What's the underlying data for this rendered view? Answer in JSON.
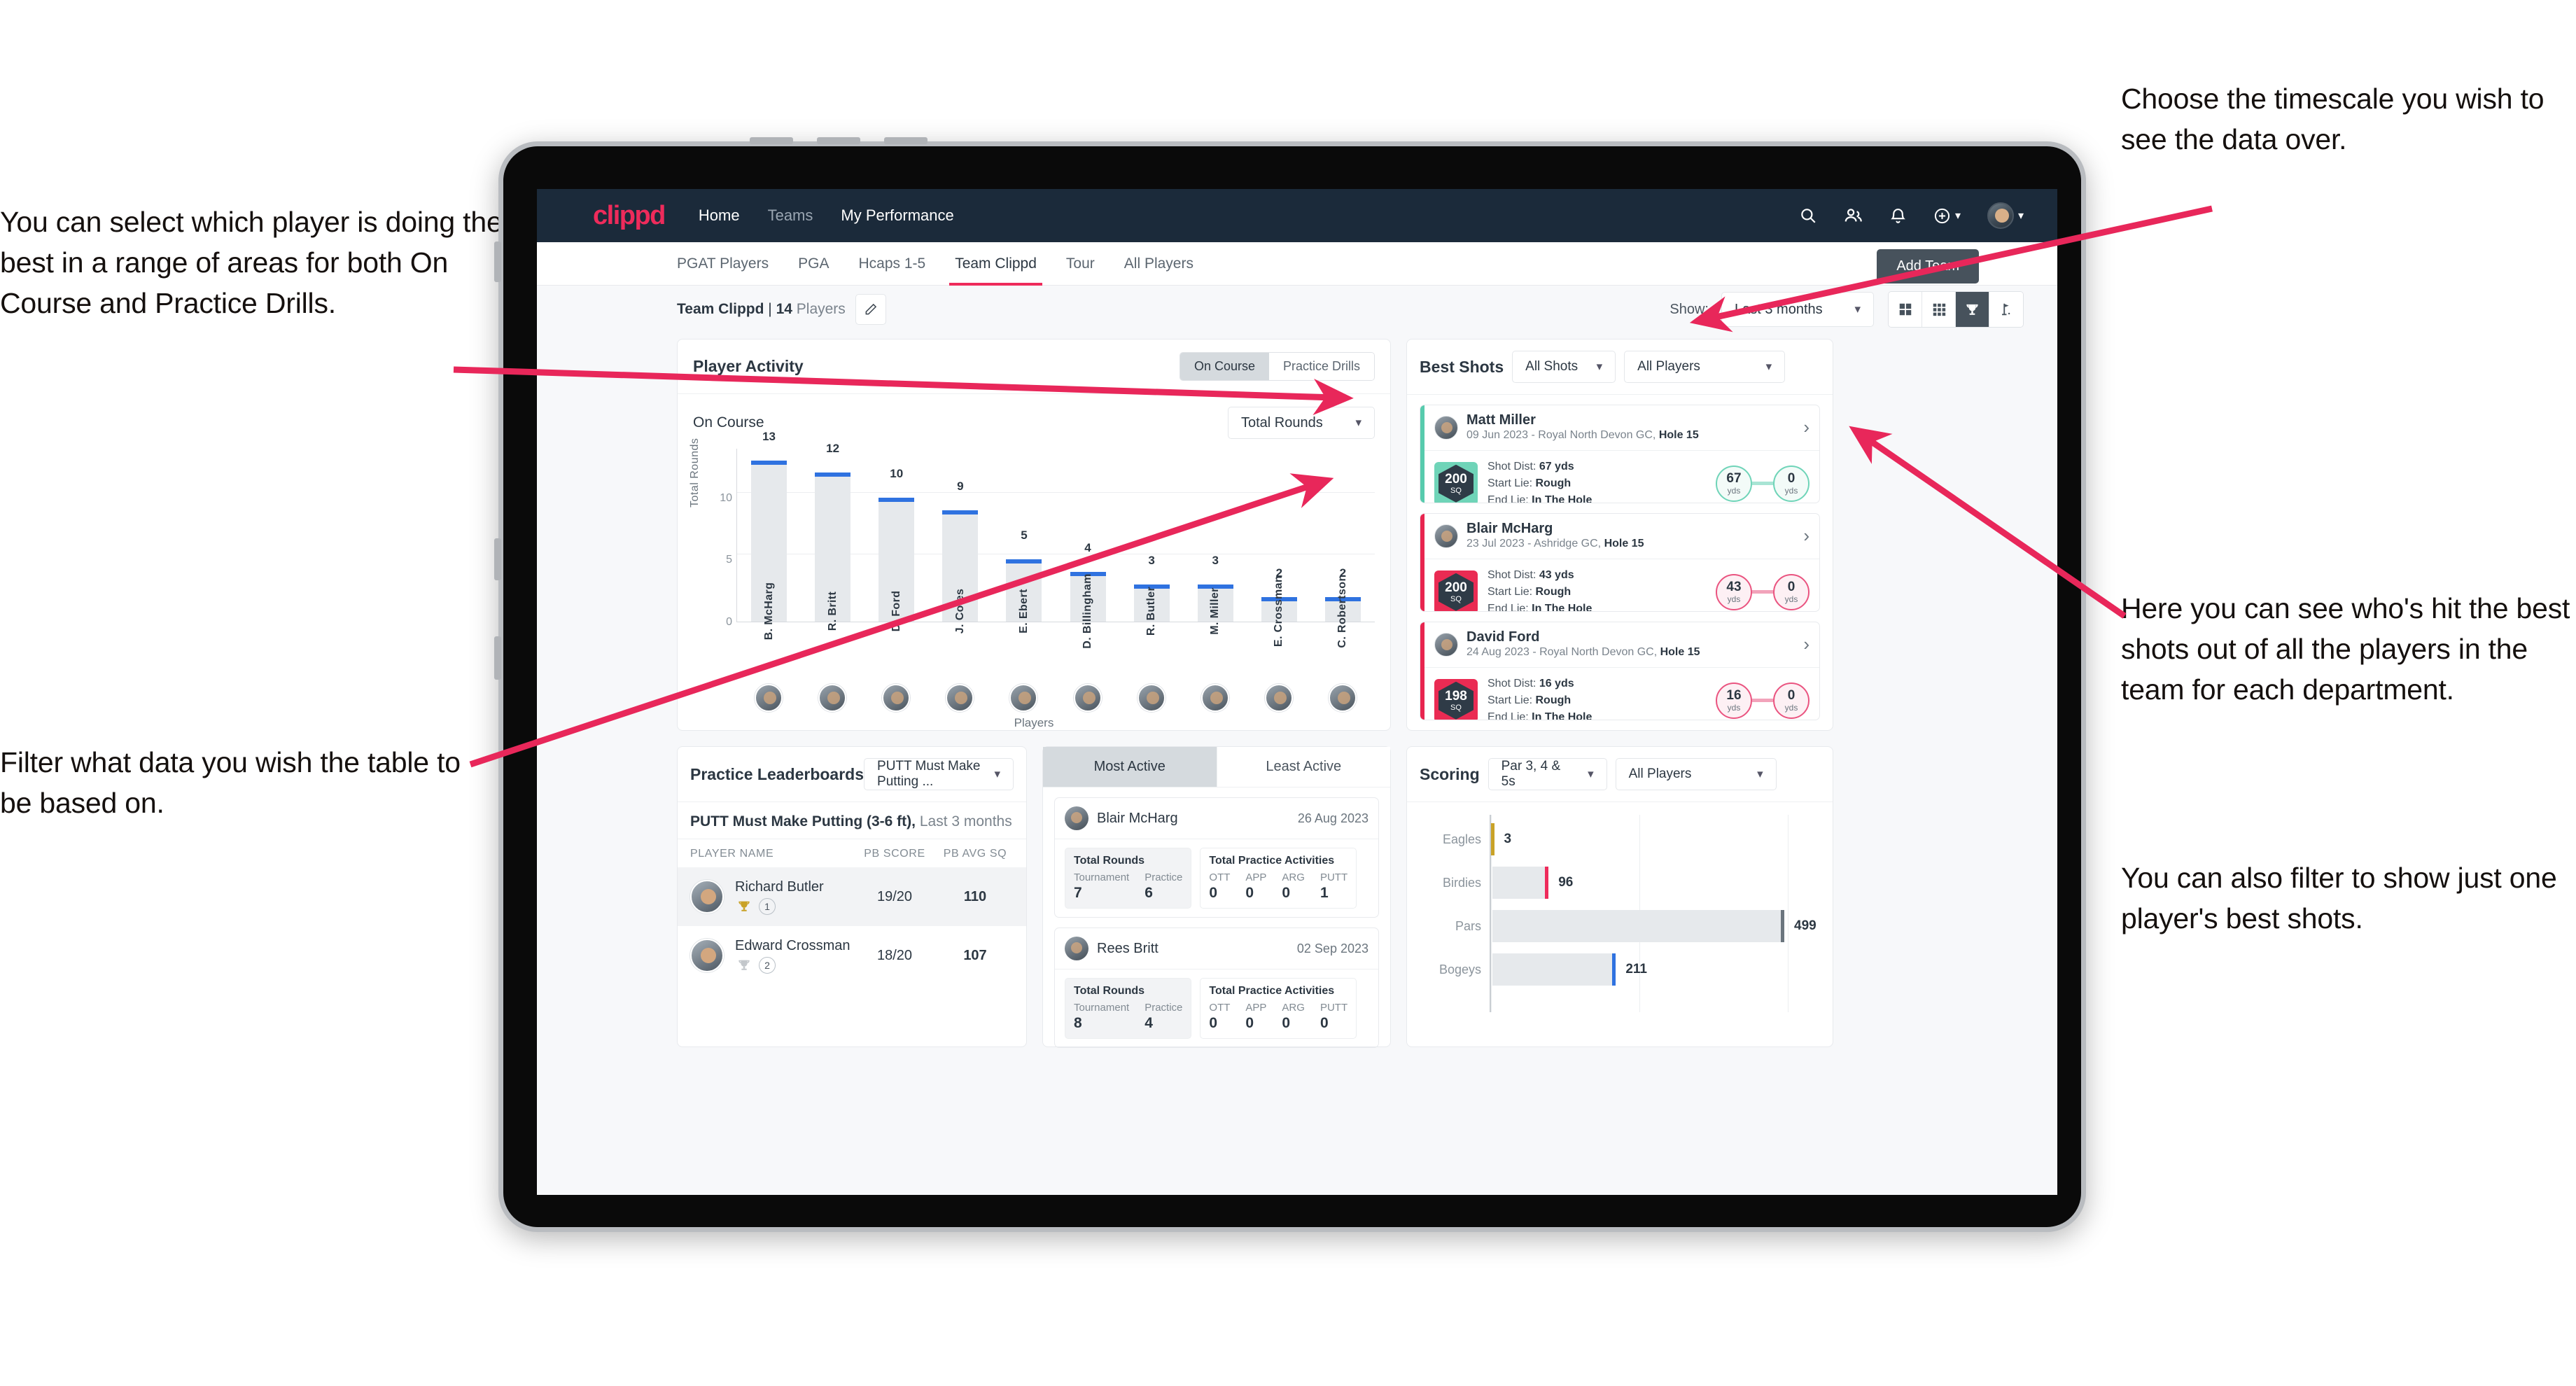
{
  "annotations": {
    "left_top": "You can select which player is doing the best in a range of areas for both On Course and Practice Drills.",
    "left_bottom": "Filter what data you wish the table to be based on.",
    "right_top": "Choose the timescale you wish to see the data over.",
    "right_middle": "Here you can see who's hit the best shots out of all the players in the team for each department.",
    "right_bottom": "You can also filter to show just one player's best shots."
  },
  "topnav": {
    "brand": "clippd",
    "links": [
      {
        "label": "Home",
        "active": true
      },
      {
        "label": "Teams",
        "active": false
      },
      {
        "label": "My Performance",
        "active": true
      }
    ],
    "icons": [
      "search-icon",
      "people-icon",
      "bell-icon",
      "plus-circle-icon",
      "avatar"
    ]
  },
  "tabs": [
    {
      "label": "PGAT Players",
      "active": false
    },
    {
      "label": "PGA",
      "active": false
    },
    {
      "label": "Hcaps 1-5",
      "active": false
    },
    {
      "label": "Team Clippd",
      "active": true
    },
    {
      "label": "Tour",
      "active": false
    },
    {
      "label": "All Players",
      "active": false
    }
  ],
  "add_team_label": "Add Team",
  "subbar": {
    "team_name": "Team Clippd",
    "separator": " | ",
    "player_count": "14",
    "players_word": " Players",
    "edit_icon": "pencil-icon",
    "show_label": "Show:",
    "timescale_value": "Last 3 months",
    "view_toggles": [
      {
        "icon": "grid-4-icon",
        "active": false
      },
      {
        "icon": "grid-9-icon",
        "active": false
      },
      {
        "icon": "trophy-icon",
        "active": true
      },
      {
        "icon": "golf-flag-icon",
        "active": false
      }
    ]
  },
  "player_activity": {
    "title": "Player Activity",
    "segments": [
      {
        "label": "On Course",
        "active": true
      },
      {
        "label": "Practice Drills",
        "active": false
      }
    ],
    "sub_label": "On Course",
    "metric_value": "Total Rounds",
    "xaxis_label": "Players"
  },
  "best_shots": {
    "title": "Best Shots",
    "shots_filter": "All Shots",
    "players_filter": "All Players",
    "cards": [
      {
        "player": "Matt Miller",
        "meta_date": "09 Jun 2023 - Royal North Devon GC, ",
        "meta_hole": "Hole 15",
        "sq": "200",
        "sq_unit": "SQ",
        "accent": "teal",
        "shot_dist_label": "Shot Dist: ",
        "shot_dist": "67 yds",
        "start_lie_label": "Start Lie: ",
        "start_lie": "Rough",
        "end_lie_label": "End Lie: ",
        "end_lie": "In The Hole",
        "from_value": "67",
        "from_unit": "yds",
        "to_value": "0",
        "to_unit": "yds"
      },
      {
        "player": "Blair McHarg",
        "meta_date": "23 Jul 2023 - Ashridge GC, ",
        "meta_hole": "Hole 15",
        "sq": "200",
        "sq_unit": "SQ",
        "accent": "pink",
        "shot_dist_label": "Shot Dist: ",
        "shot_dist": "43 yds",
        "start_lie_label": "Start Lie: ",
        "start_lie": "Rough",
        "end_lie_label": "End Lie: ",
        "end_lie": "In The Hole",
        "from_value": "43",
        "from_unit": "yds",
        "to_value": "0",
        "to_unit": "yds"
      },
      {
        "player": "David Ford",
        "meta_date": "24 Aug 2023 - Royal North Devon GC, ",
        "meta_hole": "Hole 15",
        "sq": "198",
        "sq_unit": "SQ",
        "accent": "pink",
        "shot_dist_label": "Shot Dist: ",
        "shot_dist": "16 yds",
        "start_lie_label": "Start Lie: ",
        "start_lie": "Rough",
        "end_lie_label": "End Lie: ",
        "end_lie": "In The Hole",
        "from_value": "16",
        "from_unit": "yds",
        "to_value": "0",
        "to_unit": "yds"
      }
    ]
  },
  "practice_leaderboards": {
    "title": "Practice Leaderboards",
    "drill_filter": "PUTT Must Make Putting ...",
    "subtitle_bold": "PUTT Must Make Putting (3-6 ft),",
    "subtitle_muted": " Last 3 months",
    "columns": [
      "PLAYER NAME",
      "PB SCORE",
      "PB AVG SQ"
    ],
    "rows": [
      {
        "name": "Richard Butler",
        "rank": "1",
        "trophy": "gold",
        "pb_score": "19/20",
        "pb_avg_sq": "110"
      },
      {
        "name": "Edward Crossman",
        "rank": "2",
        "trophy": "silver",
        "pb_score": "18/20",
        "pb_avg_sq": "107"
      }
    ]
  },
  "activity_panel": {
    "tabs": [
      {
        "label": "Most Active",
        "active": true
      },
      {
        "label": "Least Active",
        "active": false
      }
    ],
    "cards": [
      {
        "player": "Blair McHarg",
        "date": "26 Aug 2023",
        "rounds_title": "Total Rounds",
        "rounds_keys": [
          "Tournament",
          "Practice"
        ],
        "rounds_values": [
          "7",
          "6"
        ],
        "practice_title": "Total Practice Activities",
        "practice_keys": [
          "OTT",
          "APP",
          "ARG",
          "PUTT"
        ],
        "practice_values": [
          "0",
          "0",
          "0",
          "1"
        ]
      },
      {
        "player": "Rees Britt",
        "date": "02 Sep 2023",
        "rounds_title": "Total Rounds",
        "rounds_keys": [
          "Tournament",
          "Practice"
        ],
        "rounds_values": [
          "8",
          "4"
        ],
        "practice_title": "Total Practice Activities",
        "practice_keys": [
          "OTT",
          "APP",
          "ARG",
          "PUTT"
        ],
        "practice_values": [
          "0",
          "0",
          "0",
          "0"
        ]
      }
    ]
  },
  "scoring": {
    "title": "Scoring",
    "par_filter": "Par 3, 4 & 5s",
    "players_filter": "All Players"
  },
  "colors": {
    "brand_pink": "#ee2b5b",
    "navy": "#1b2a3a",
    "bar_blue": "#2f72e0",
    "teal": "#6fd4b8",
    "arrow_pink": "#e8275a",
    "gold": "#c9a227",
    "silver": "#c3c7cb"
  },
  "chart_data": [
    {
      "type": "bar",
      "title": "Player Activity - On Course",
      "xlabel": "Players",
      "ylabel": "Total Rounds",
      "ylim": [
        0,
        14
      ],
      "yticks": [
        0,
        5,
        10
      ],
      "grid": true,
      "categories": [
        "B. McHarg",
        "R. Britt",
        "D. Ford",
        "J. Coles",
        "E. Ebert",
        "D. Billingham",
        "R. Butler",
        "M. Miller",
        "E. Crossman",
        "C. Robertson"
      ],
      "values": [
        13,
        12,
        10,
        9,
        5,
        4,
        3,
        3,
        2,
        2
      ]
    },
    {
      "type": "bar",
      "title": "Scoring",
      "orientation": "horizontal",
      "categories": [
        "Eagles",
        "Birdies",
        "Pars",
        "Bogeys"
      ],
      "values": [
        3,
        96,
        499,
        211
      ],
      "xlim": [
        0,
        560
      ],
      "grid": true,
      "bar_colors": [
        "#c9a227",
        "#ee2b5b",
        "#6b757e",
        "#2f72e0"
      ]
    }
  ]
}
